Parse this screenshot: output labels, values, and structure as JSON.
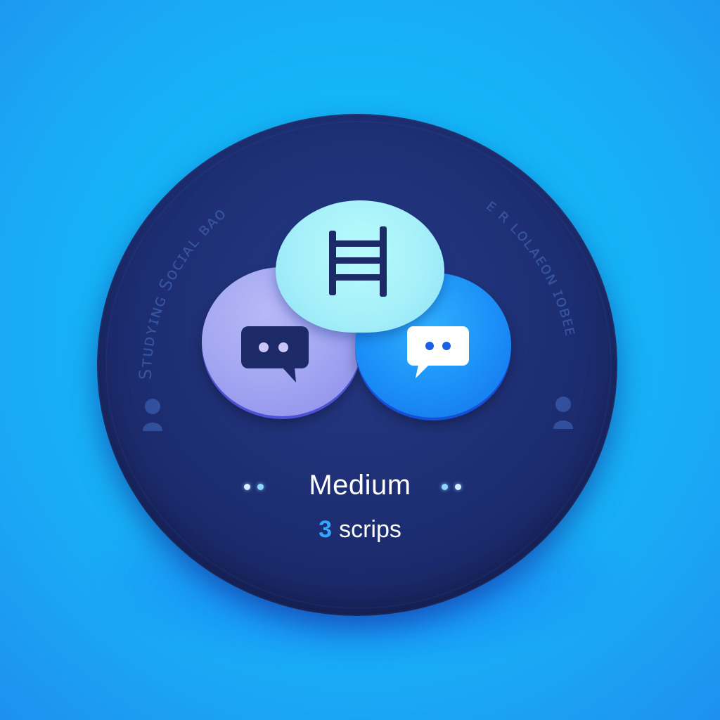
{
  "badge": {
    "level_label": "Medium",
    "count_number": "3",
    "count_unit": "scrips",
    "left_arc_text": "Sᴛᴜᴅʏɪɴɢ Sᴏᴄɪᴀʟ ʙᴀᴏ",
    "right_arc_text": "ᴇ ʀ ʟᴏʟᴀᴇᴏɴ ɪᴏʙᴇᴇ"
  },
  "colors": {
    "background": "#17c7ff",
    "badge": "#1e2f75",
    "bubble_left": "#a3a6f2",
    "bubble_right": "#1b8ff7",
    "bubble_top": "#a6f0fa",
    "accent": "#33a7ff"
  },
  "icons": {
    "top": "ladder-icon",
    "left": "chat-bubble-icon",
    "right": "chat-bubble-icon",
    "side_left": "person-icon",
    "side_right": "person-icon"
  }
}
